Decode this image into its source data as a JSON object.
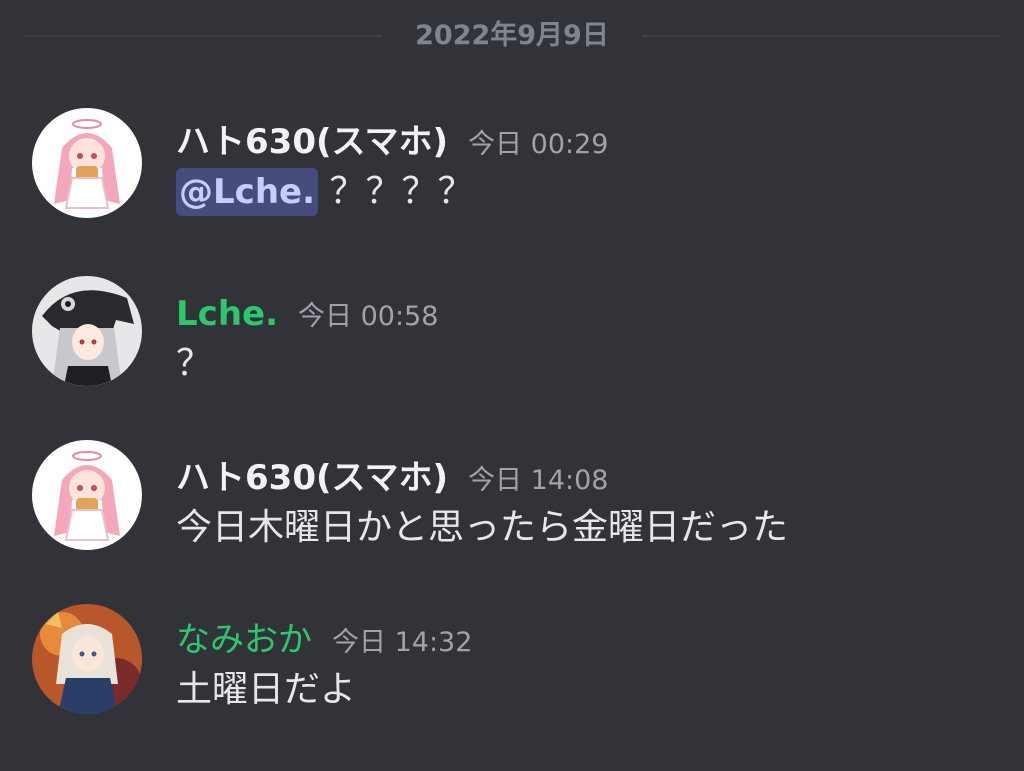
{
  "date_divider": {
    "label": "2022年9月9日"
  },
  "messages": [
    {
      "author": "ハト630(スマホ)",
      "timestamp": "今日 00:29",
      "mention": "@Lche.",
      "text": " ？？？？"
    },
    {
      "author": "Lche.",
      "timestamp": "今日 00:58",
      "text": "？"
    },
    {
      "author": "ハト630(スマホ)",
      "timestamp": "今日 14:08",
      "text": "今日木曜日かと思ったら金曜日だった"
    },
    {
      "author": "なみおか",
      "timestamp": "今日 14:32",
      "text": "土曜日だよ"
    }
  ],
  "colors": {
    "background": "#313338",
    "username_default": "#f2f3f5",
    "username_green": "#2dc770",
    "mention_bg": "#474c7e",
    "timestamp": "#a0a3aa"
  },
  "icons": {
    "avatar_1": "pink-haired-character-avatar",
    "avatar_2": "silver-haired-character-with-black-hood-avatar",
    "avatar_3": "pink-haired-character-avatar",
    "avatar_4": "blonde-character-orange-background-avatar"
  }
}
